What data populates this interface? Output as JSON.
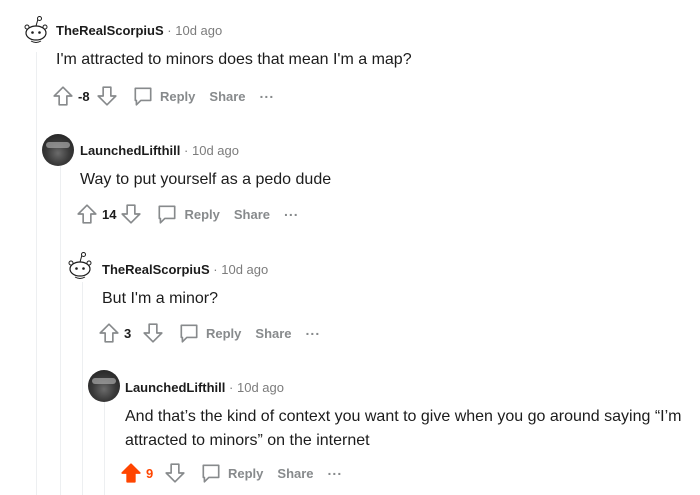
{
  "comments": [
    {
      "username": "TheRealScorpiuS",
      "time": "10d ago",
      "text": "I'm attracted to minors does that mean I'm a map?",
      "score": "-8",
      "reply_label": "Reply",
      "share_label": "Share",
      "more_label": "...",
      "avatar_icon": "snoo-avatar-icon"
    },
    {
      "username": "LaunchedLifthill",
      "time": "10d ago",
      "text": "Way to put yourself as a pedo dude",
      "score": "14",
      "reply_label": "Reply",
      "share_label": "Share",
      "more_label": "...",
      "avatar_icon": "user-photo-avatar-icon"
    },
    {
      "username": "TheRealScorpiuS",
      "time": "10d ago",
      "text": "But I'm a minor?",
      "score": "3",
      "reply_label": "Reply",
      "share_label": "Share",
      "more_label": "...",
      "avatar_icon": "snoo-avatar-icon"
    },
    {
      "username": "LaunchedLifthill",
      "time": "10d ago",
      "text_line1": "And that’s the kind of context you want to give when you go around saying “I’m",
      "text_line2": "attracted to minors” on the internet",
      "score": "9",
      "upvoted": true,
      "reply_label": "Reply",
      "share_label": "Share",
      "more_label": "...",
      "avatar_icon": "user-photo-avatar-icon"
    }
  ],
  "separator": "·",
  "colors": {
    "upvote_active": "#ff4500",
    "meta_gray": "#7c7c7c",
    "action_gray": "#878a8c"
  }
}
